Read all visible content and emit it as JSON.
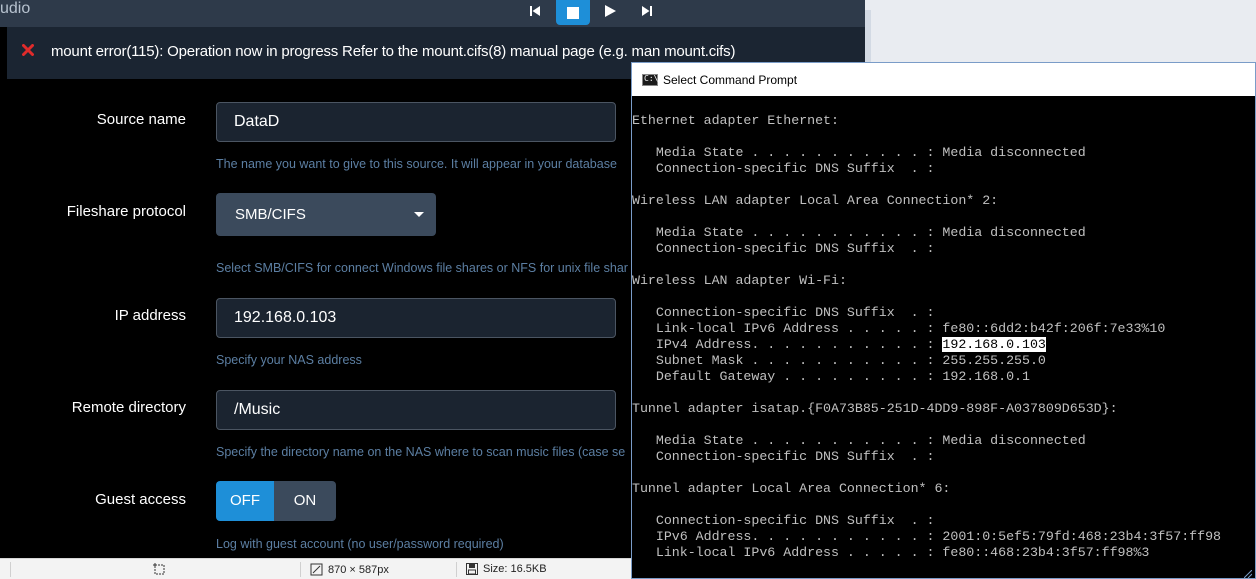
{
  "app": {
    "title": "udio",
    "controls": [
      "skip-back-icon",
      "stop-icon",
      "play-icon",
      "skip-forward-icon"
    ],
    "accent_color": "#1e8fd8",
    "error": {
      "icon": "close-icon",
      "color": "#e02b2b",
      "message": "mount error(115): Operation now in progress Refer to the mount.cifs(8) manual page (e.g. man mount.cifs)"
    },
    "form": {
      "source_name": {
        "label": "Source name",
        "value": "DataD",
        "help": "The name you want to give to this source. It will appear in your database"
      },
      "protocol": {
        "label": "Fileshare protocol",
        "value": "SMB/CIFS",
        "help": "Select SMB/CIFS for connect Windows file shares or NFS for unix file shar"
      },
      "ip_address": {
        "label": "IP address",
        "value": "192.168.0.103",
        "help": "Specify your NAS address"
      },
      "remote_directory": {
        "label": "Remote directory",
        "value": "/Music",
        "help": "Specify the directory name on the NAS where to scan music files (case se"
      },
      "guest_access": {
        "label": "Guest access",
        "off_label": "OFF",
        "on_label": "ON",
        "selected": "OFF",
        "help": "Log with guest account (no user/password required)"
      }
    }
  },
  "statusbar": {
    "dimensions": "870 × 587px",
    "size": "Size: 16.5KB"
  },
  "cmd": {
    "title": "Select Command Prompt",
    "icon_text": "C:\\",
    "lines": [
      "",
      "Ethernet adapter Ethernet:",
      "",
      "   Media State . . . . . . . . . . . : Media disconnected",
      "   Connection-specific DNS Suffix  . :",
      "",
      "Wireless LAN adapter Local Area Connection* 2:",
      "",
      "   Media State . . . . . . . . . . . : Media disconnected",
      "   Connection-specific DNS Suffix  . :",
      "",
      "Wireless LAN adapter Wi-Fi:",
      "",
      "   Connection-specific DNS Suffix  . :",
      "   Link-local IPv6 Address . . . . . : fe80::6dd2:b42f:206f:7e33%10",
      "   IPv4 Address. . . . . . . . . . . : ",
      "   Subnet Mask . . . . . . . . . . . : 255.255.255.0",
      "   Default Gateway . . . . . . . . . : 192.168.0.1",
      "",
      "Tunnel adapter isatap.{F0A73B85-251D-4DD9-898F-A037809D653D}:",
      "",
      "   Media State . . . . . . . . . . . : Media disconnected",
      "   Connection-specific DNS Suffix  . :",
      "",
      "Tunnel adapter Local Area Connection* 6:",
      "",
      "   Connection-specific DNS Suffix  . :",
      "   IPv6 Address. . . . . . . . . . . : 2001:0:5ef5:79fd:468:23b4:3f57:ff98",
      "   Link-local IPv6 Address . . . . . : fe80::468:23b4:3f57:ff98%3"
    ],
    "highlighted_ip": "192.168.0.103"
  }
}
